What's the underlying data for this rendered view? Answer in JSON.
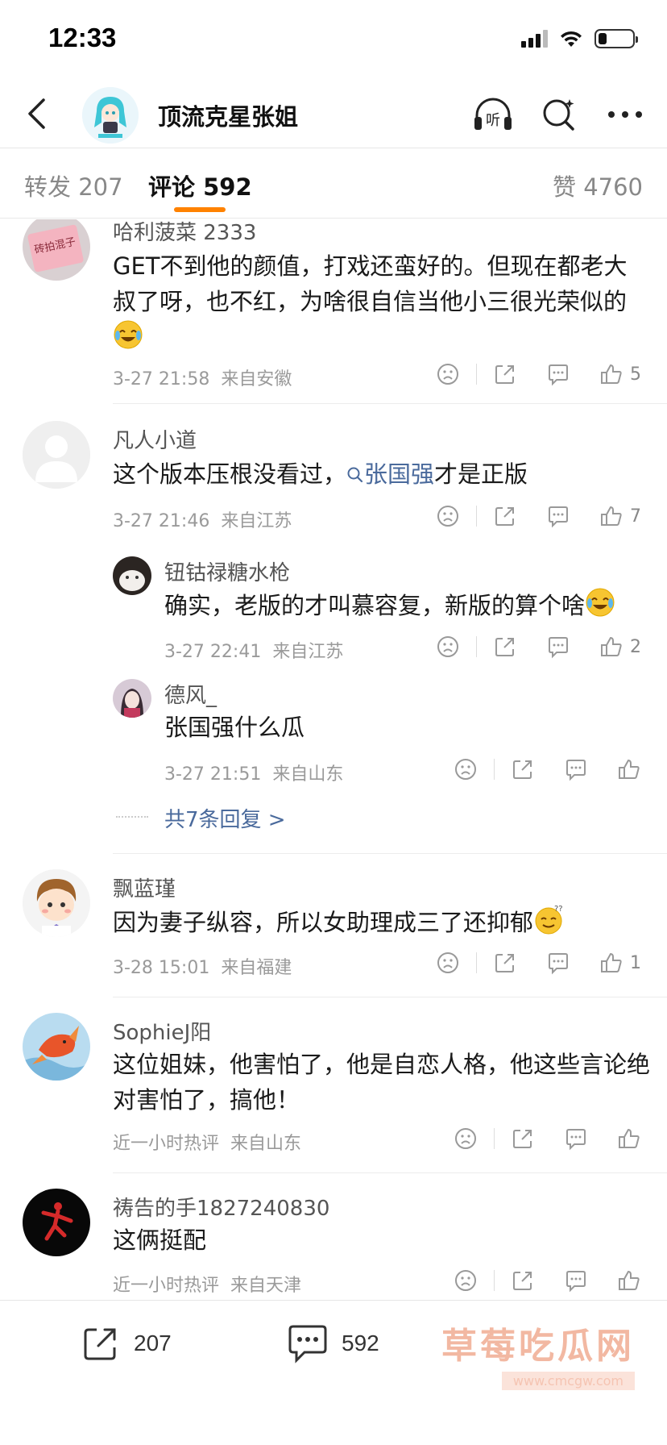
{
  "status": {
    "time": "12:33"
  },
  "header": {
    "title": "顶流克星张姐"
  },
  "tabs": [
    {
      "label": "转发",
      "count": "207"
    },
    {
      "label": "评论",
      "count": "592"
    },
    {
      "label": "赞",
      "count": "4760"
    }
  ],
  "comments": [
    {
      "user": "哈利菠菜 2333",
      "avatar_text": "砖拍混子",
      "text": "GET不到他的颜值，打戏还蛮好的。但现在都老大叔了呀，也不红，为啥很自信当他小三很光荣似的",
      "date": "3-27 21:58",
      "location": "来自安徽",
      "likes": "5"
    },
    {
      "user": "凡人小道",
      "text_pre": "这个版本压根没看过，",
      "text_link": "张国强",
      "text_post": "才是正版",
      "date": "3-27 21:46",
      "location": "来自江苏",
      "likes": "7",
      "replies": [
        {
          "user": "钮钴禄糖水枪",
          "text": "确实，老版的才叫慕容复，新版的算个啥",
          "date": "3-27 22:41",
          "location": "来自江苏",
          "likes": "2"
        },
        {
          "user": "德风_",
          "text": "张国强什么瓜",
          "date": "3-27 21:51",
          "location": "来自山东",
          "likes": ""
        }
      ],
      "more_replies": "共7条回复 >"
    },
    {
      "user": "飘蓝瑾",
      "text": "因为妻子纵容，所以女助理成三了还抑郁",
      "date": "3-28 15:01",
      "location": "来自福建",
      "likes": "1"
    },
    {
      "user": "SophieJ阳",
      "text": "这位姐妹，他害怕了，他是自恋人格，他这些言论绝对害怕了，搞他！",
      "date": "近一小时热评",
      "location": "来自山东",
      "likes": ""
    },
    {
      "user": "祷告的手1827240830",
      "text": "这俩挺配",
      "date": "近一小时热评",
      "location": "来自天津",
      "likes": ""
    }
  ],
  "bottom": {
    "repost_count": "207",
    "comment_count": "592"
  },
  "watermark": {
    "title": "草莓吃瓜网",
    "url": "www.cmcgw.com"
  },
  "colors": {
    "accent": "#ff8200",
    "link": "#4a6a9c"
  }
}
